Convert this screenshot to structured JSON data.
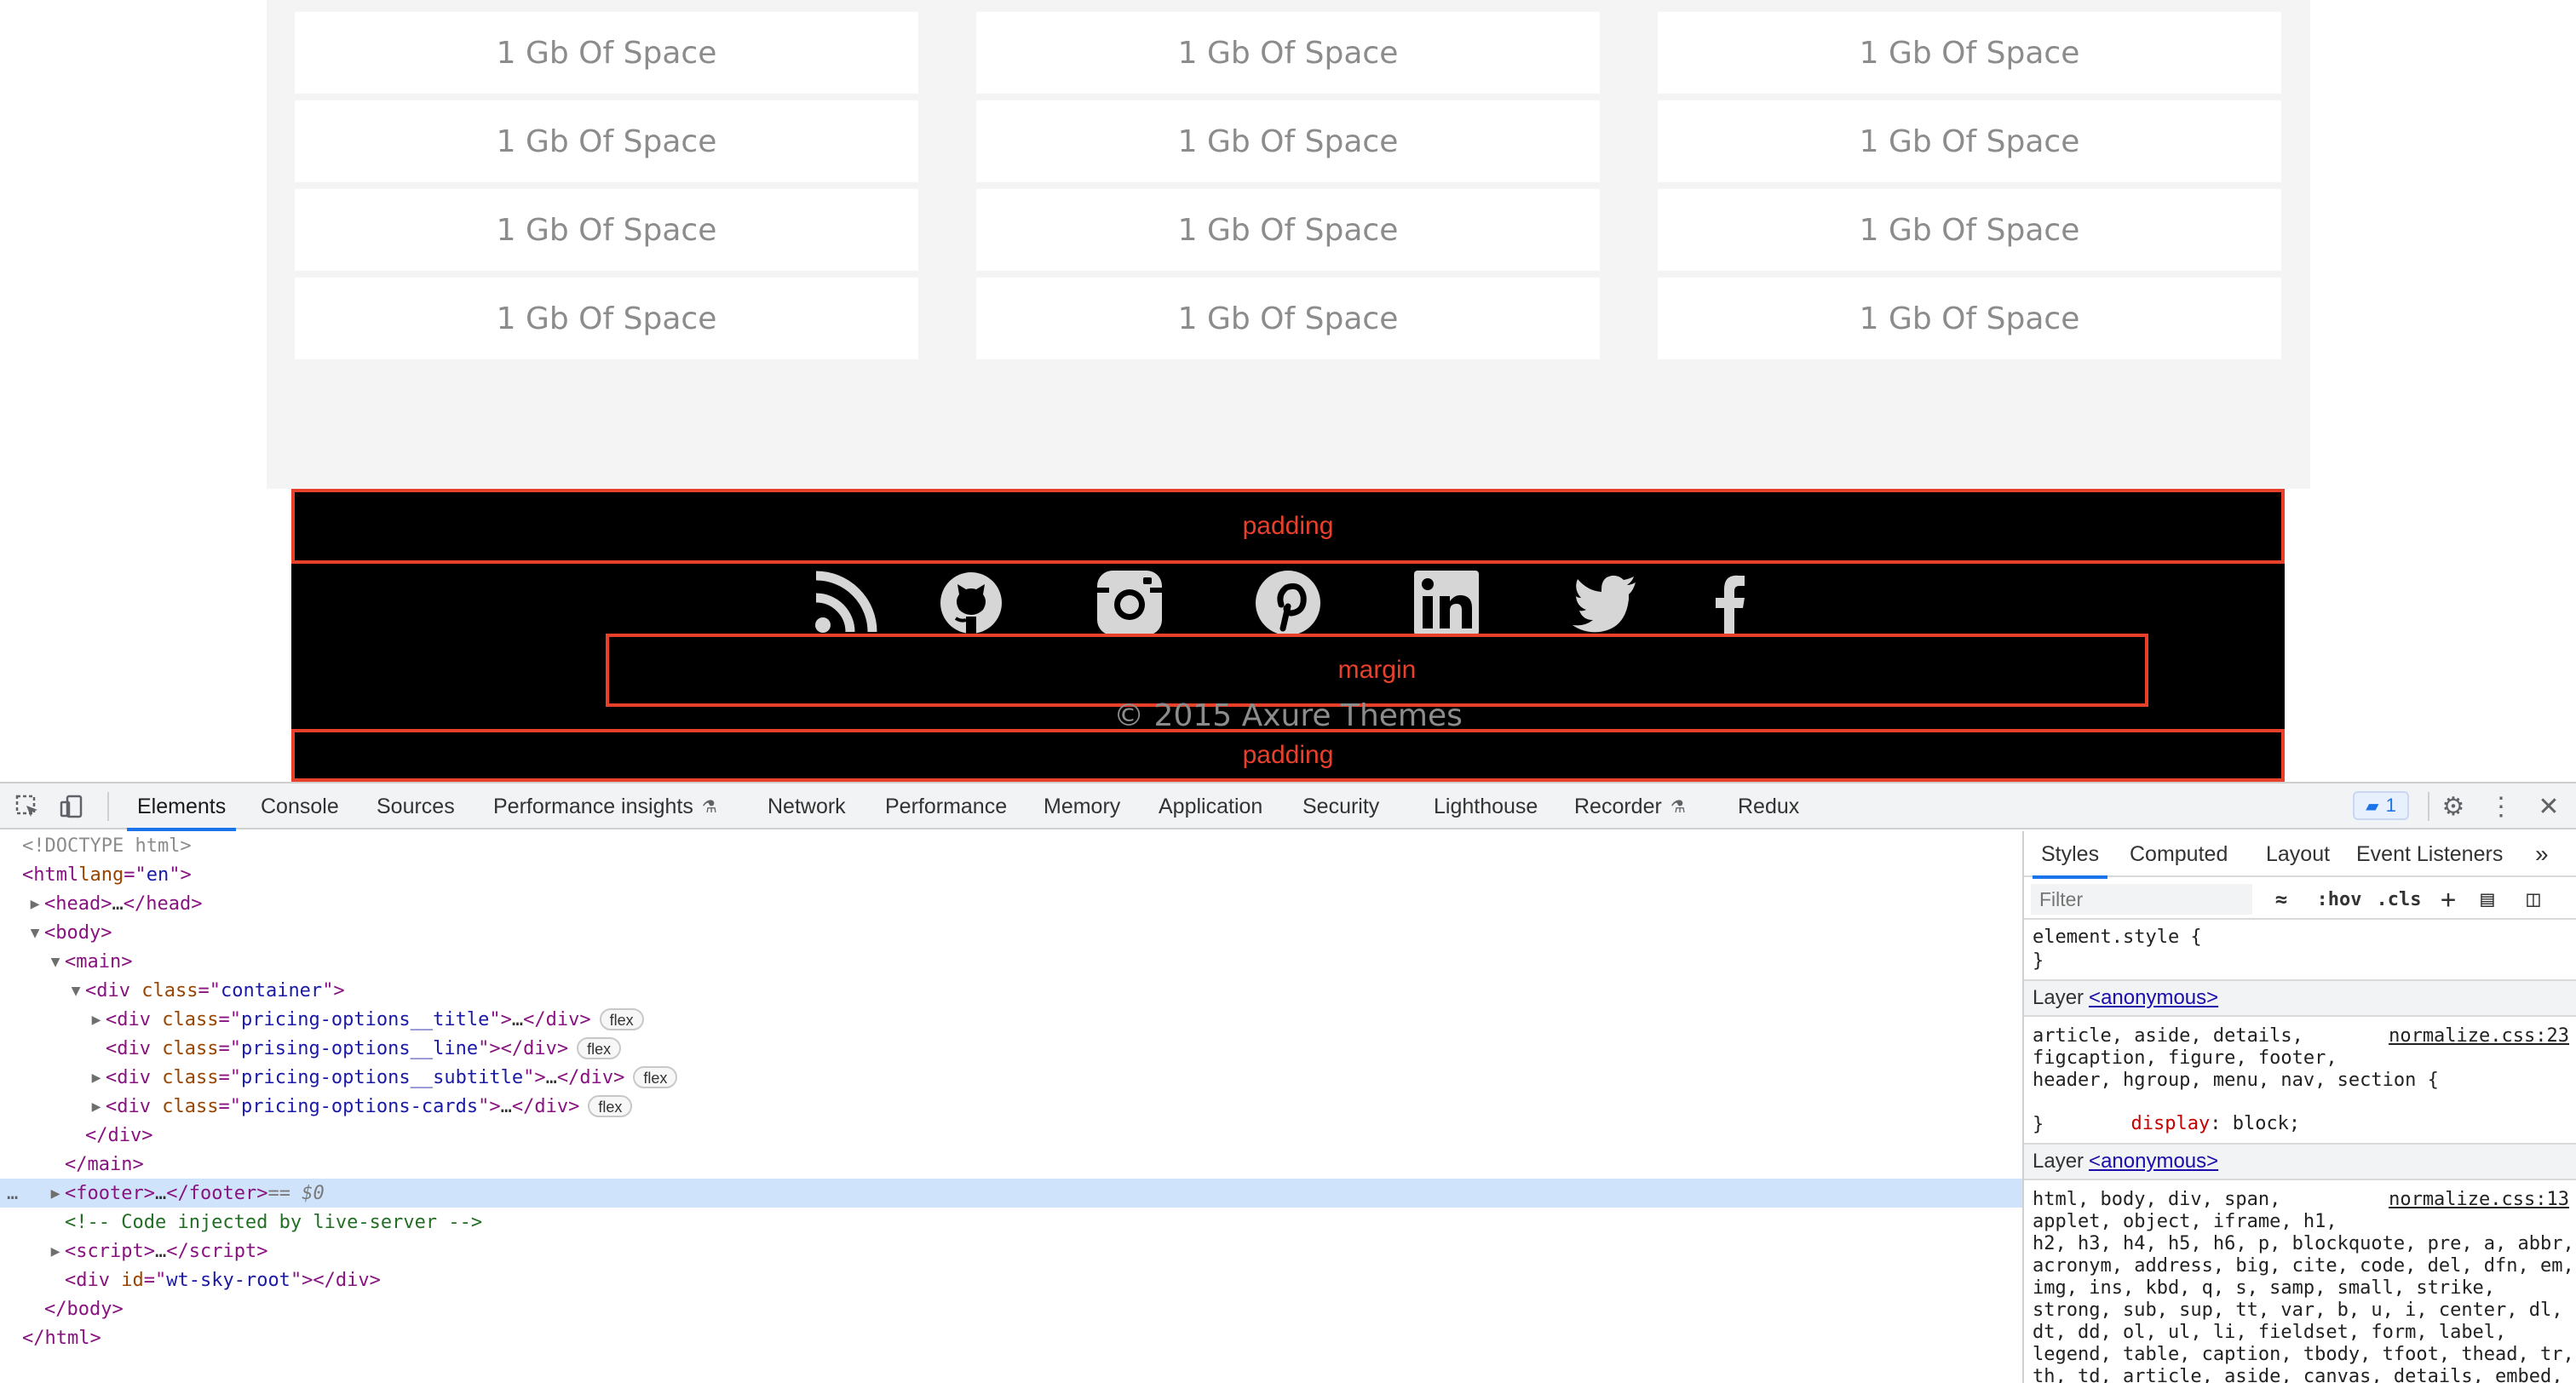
{
  "pricing_cards": {
    "columns": [
      {
        "items": [
          "1 Gb Of Space",
          "1 Gb Of Space",
          "1 Gb Of Space",
          "1 Gb Of Space"
        ]
      },
      {
        "items": [
          "1 Gb Of Space",
          "1 Gb Of Space",
          "1 Gb Of Space",
          "1 Gb Of Space"
        ]
      },
      {
        "items": [
          "1 Gb Of Space",
          "1 Gb Of Space",
          "1 Gb Of Space",
          "1 Gb Of Space"
        ]
      }
    ]
  },
  "footer": {
    "overlay_top_label": "padding",
    "overlay_margin_label": "margin",
    "overlay_bottom_label": "padding",
    "social_icons": [
      "rss-icon",
      "github-icon",
      "instagram-icon",
      "pinterest-icon",
      "linkedin-icon",
      "twitter-icon",
      "facebook-icon"
    ],
    "copyright": "© 2015 Axure Themes"
  },
  "devtools": {
    "tabs": [
      "Elements",
      "Console",
      "Sources",
      "Performance insights",
      "Network",
      "Performance",
      "Memory",
      "Application",
      "Security",
      "Lighthouse",
      "Recorder",
      "Redux"
    ],
    "active_tab": "Elements",
    "issues_count": "1",
    "dom": {
      "doctype": "<!DOCTYPE html>",
      "html_tag": "html",
      "html_attr": "lang",
      "html_val": "en",
      "head": "head",
      "body": "body",
      "main": "main",
      "container_class": "container",
      "child1_class": "pricing-options__title",
      "child2_class": "prising-options__line",
      "child3_class": "pricing-options__subtitle",
      "child4_class": "pricing-options-cards",
      "pill": "flex",
      "footer": "footer",
      "eq": "== $0",
      "comment": "<!-- Code injected by live-server -->",
      "script": "script",
      "root_id": "wt-sky-root"
    },
    "styles": {
      "tabs": [
        "Styles",
        "Computed",
        "Layout",
        "Event Listeners"
      ],
      "active_tab": "Styles",
      "filter_placeholder": "Filter",
      "hov": ":hov",
      "cls": ".cls",
      "element_style": "element.style {",
      "close_brace": "}",
      "layer_label": "Layer",
      "layer_name": "<anonymous>",
      "rule1_selector": [
        "article, aside, details,",
        "figcaption, figure, footer,",
        "header, hgroup, menu, nav, section {"
      ],
      "rule1_source": "normalize.css:23",
      "rule1_prop": "display",
      "rule1_value": "block;",
      "rule2_selector": [
        "html, body, div, span,",
        "applet, object, iframe, h1,",
        "h2, h3, h4, h5, h6, p, blockquote, pre, a, abbr,",
        "acronym, address, big, cite, code, del, dfn, em,",
        "img, ins, kbd, q, s, samp, small, strike,",
        "strong, sub, sup, tt, var, b, u, i, center, dl,",
        "dt, dd, ol, ul, li, fieldset, form, label,",
        "legend, table, caption, tbody, tfoot, thead, tr,",
        "th, td, article, aside, canvas, details, embed,"
      ],
      "rule2_source": "normalize.css:13"
    }
  }
}
